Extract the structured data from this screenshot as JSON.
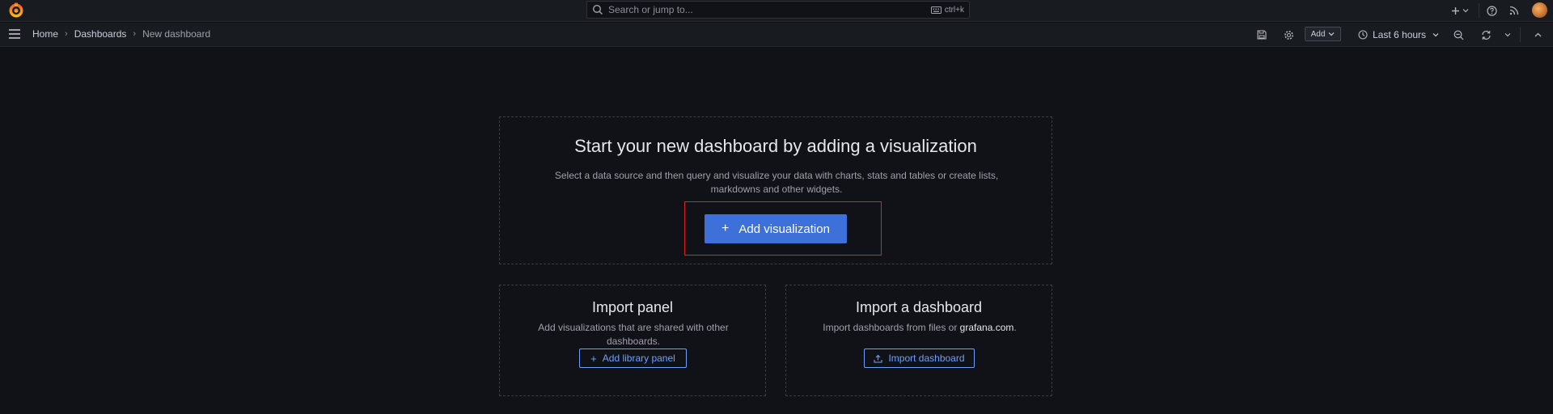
{
  "topbar": {
    "search_placeholder": "Search or jump to...",
    "shortcut": "ctrl+k",
    "icons": [
      "grafana-logo-icon",
      "plus-icon",
      "chevron-down-icon",
      "help-icon",
      "news-rss-icon",
      "avatar"
    ]
  },
  "navbar": {
    "breadcrumb": [
      "Home",
      "Dashboards",
      "New dashboard"
    ],
    "separator": "›",
    "add_label": "Add",
    "time_range": "Last 6 hours"
  },
  "main_card": {
    "title": "Start your new dashboard by adding a visualization",
    "description_line1": "Select a data source and then query and visualize your data with charts, stats and tables or create lists,",
    "description_line2": "markdowns and other widgets.",
    "button_label": "Add visualization",
    "button_icon": "+"
  },
  "import_panel": {
    "title": "Import panel",
    "description_line1": "Add visualizations that are shared with other",
    "description_line2": "dashboards.",
    "button_label": "Add library panel",
    "button_icon": "+"
  },
  "import_dashboard": {
    "title": "Import a dashboard",
    "description_prefix": "Import dashboards from files or ",
    "description_link": "grafana.com",
    "description_suffix": ".",
    "button_label": "Import dashboard"
  },
  "colors": {
    "background": "#111217",
    "primary": "#3d71d9",
    "link": "#6e9fff",
    "highlight": "#e02020"
  }
}
